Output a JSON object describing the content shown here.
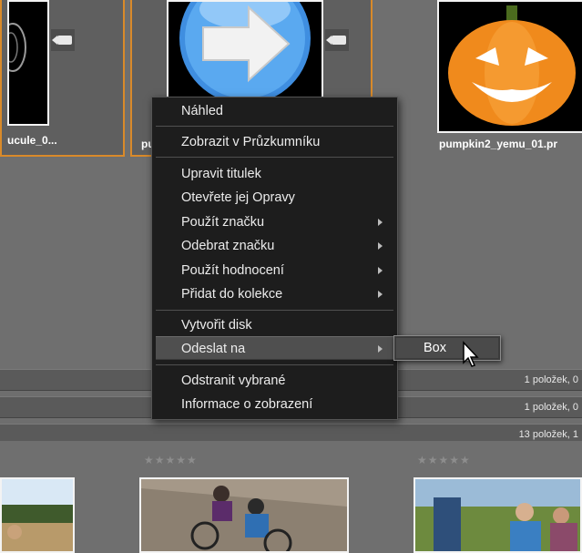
{
  "thumbnails": [
    {
      "caption": "ucule_0...",
      "selected": true
    },
    {
      "caption": "pu",
      "selected": true
    },
    {
      "caption": "pumpkin2_yemu_01.pr",
      "selected": false
    }
  ],
  "groups": [
    {
      "count": "1 položek, 0"
    },
    {
      "count": "1 položek, 0"
    },
    {
      "count": "13 položek, 1"
    }
  ],
  "rating_stars": "★★★★★",
  "context_menu": {
    "items": [
      {
        "label": "Náhled"
      },
      {
        "label": "Zobrazit v Průzkumníku"
      },
      {
        "label": "Upravit titulek"
      },
      {
        "label": "Otevřete jej Opravy"
      },
      {
        "label": "Použít značku",
        "submenu": true
      },
      {
        "label": "Odebrat značku",
        "submenu": true
      },
      {
        "label": "Použít hodnocení",
        "submenu": true
      },
      {
        "label": "Přidat do kolekce",
        "submenu": true
      },
      {
        "label": "Vytvořit disk"
      },
      {
        "label": "Odeslat na",
        "submenu": true,
        "active": true
      },
      {
        "label": "Odstranit vybrané"
      },
      {
        "label": "Informace o zobrazení"
      }
    ]
  },
  "submenu": {
    "items": [
      {
        "label": "Box"
      }
    ]
  },
  "colors": {
    "selection_border": "#d98a2a",
    "menu_background": "#1d1d1d",
    "pumpkin": "#f08a1c"
  }
}
